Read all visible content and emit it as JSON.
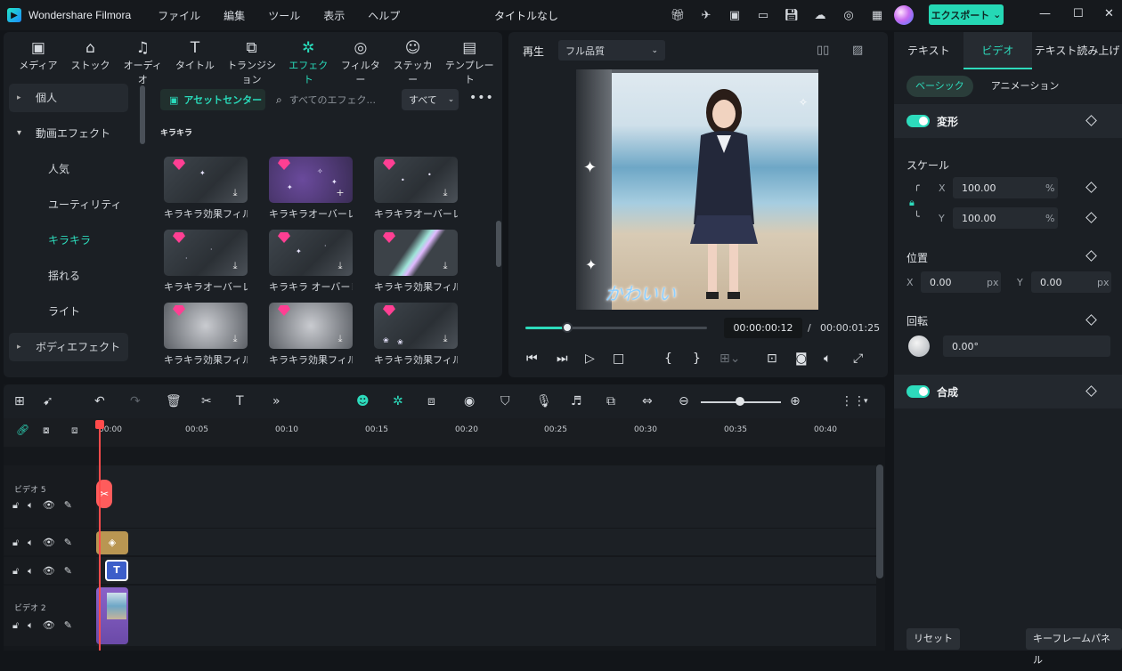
{
  "app": {
    "name": "Wondershare Filmora",
    "doc_title": "タイトルなし",
    "export_label": "エクスポート"
  },
  "menu": [
    "ファイル",
    "編集",
    "ツール",
    "表示",
    "ヘルプ"
  ],
  "categories": [
    {
      "label": "メディア",
      "icon": "media-icon"
    },
    {
      "label": "ストック",
      "icon": "stock-icon"
    },
    {
      "label": "オーディオ",
      "icon": "music-note-icon"
    },
    {
      "label": "タイトル",
      "icon": "title-icon"
    },
    {
      "label": "トランジション",
      "icon": "transition-icon"
    },
    {
      "label": "エフェクト",
      "icon": "effect-icon"
    },
    {
      "label": "フィルター",
      "icon": "filter-icon"
    },
    {
      "label": "ステッカー",
      "icon": "sticker-icon"
    },
    {
      "label": "テンプレート",
      "icon": "template-icon"
    }
  ],
  "sidebar": {
    "items": [
      {
        "label": "個人",
        "kind": "group"
      },
      {
        "label": "動画エフェクト",
        "kind": "open"
      },
      {
        "label": "人気",
        "kind": "sub"
      },
      {
        "label": "ユーティリティ",
        "kind": "sub"
      },
      {
        "label": "キラキラ",
        "kind": "sub-selected"
      },
      {
        "label": "揺れる",
        "kind": "sub"
      },
      {
        "label": "ライト",
        "kind": "sub"
      },
      {
        "label": "ボディエフェクト",
        "kind": "group"
      }
    ]
  },
  "effects": {
    "asset_center": "アセットセンター",
    "search_placeholder": "すべてのエフェク...",
    "filter": "すべて",
    "section_title": "キラキラ",
    "cards": [
      {
        "label": "キラキラ効果フィル...",
        "action": "download"
      },
      {
        "label": "キラキラオーバーレ...",
        "action": "add"
      },
      {
        "label": "キラキラオーバーレ...",
        "action": "download"
      },
      {
        "label": "キラキラオーバーレ...",
        "action": "download"
      },
      {
        "label": "キラキラ オーバーレ...",
        "action": "download"
      },
      {
        "label": "キラキラ効果フィル...",
        "action": "download"
      },
      {
        "label": "キラキラ効果フィル...",
        "action": "download"
      },
      {
        "label": "キラキラ効果フィル...",
        "action": "download"
      },
      {
        "label": "キラキラ効果フィル...",
        "action": "download"
      }
    ]
  },
  "preview": {
    "play_label": "再生",
    "quality": "フル品質",
    "overlay_text": "かわいい",
    "current_time": "00:00:00:12",
    "separator": "/",
    "total_time": "00:00:01:25",
    "progress": 0.23
  },
  "timeline": {
    "ruler": [
      "00:00",
      "00:05",
      "00:10",
      "00:15",
      "00:20",
      "00:25",
      "00:30",
      "00:35",
      "00:40"
    ],
    "tracks": [
      "ビデオ 5",
      "",
      "",
      "ビデオ 2"
    ]
  },
  "props": {
    "tabs": [
      "テキスト",
      "ビデオ",
      "テキスト読み上げ"
    ],
    "subtabs": [
      "ベーシック",
      "アニメーション"
    ],
    "transform": "変形",
    "scale": "スケール",
    "scale_x": "100.00",
    "scale_y": "100.00",
    "percent": "%",
    "position": "位置",
    "pos_x": "0.00",
    "pos_y": "0.00",
    "px": "px",
    "rotation": "回転",
    "rot_value": "0.00°",
    "composite": "合成",
    "reset": "リセット",
    "keyframe_panel": "キーフレームパネル",
    "x": "X",
    "y": "Y"
  },
  "colors": {
    "accent": "#2ddbbc",
    "playhead": "#ff4b4b"
  }
}
